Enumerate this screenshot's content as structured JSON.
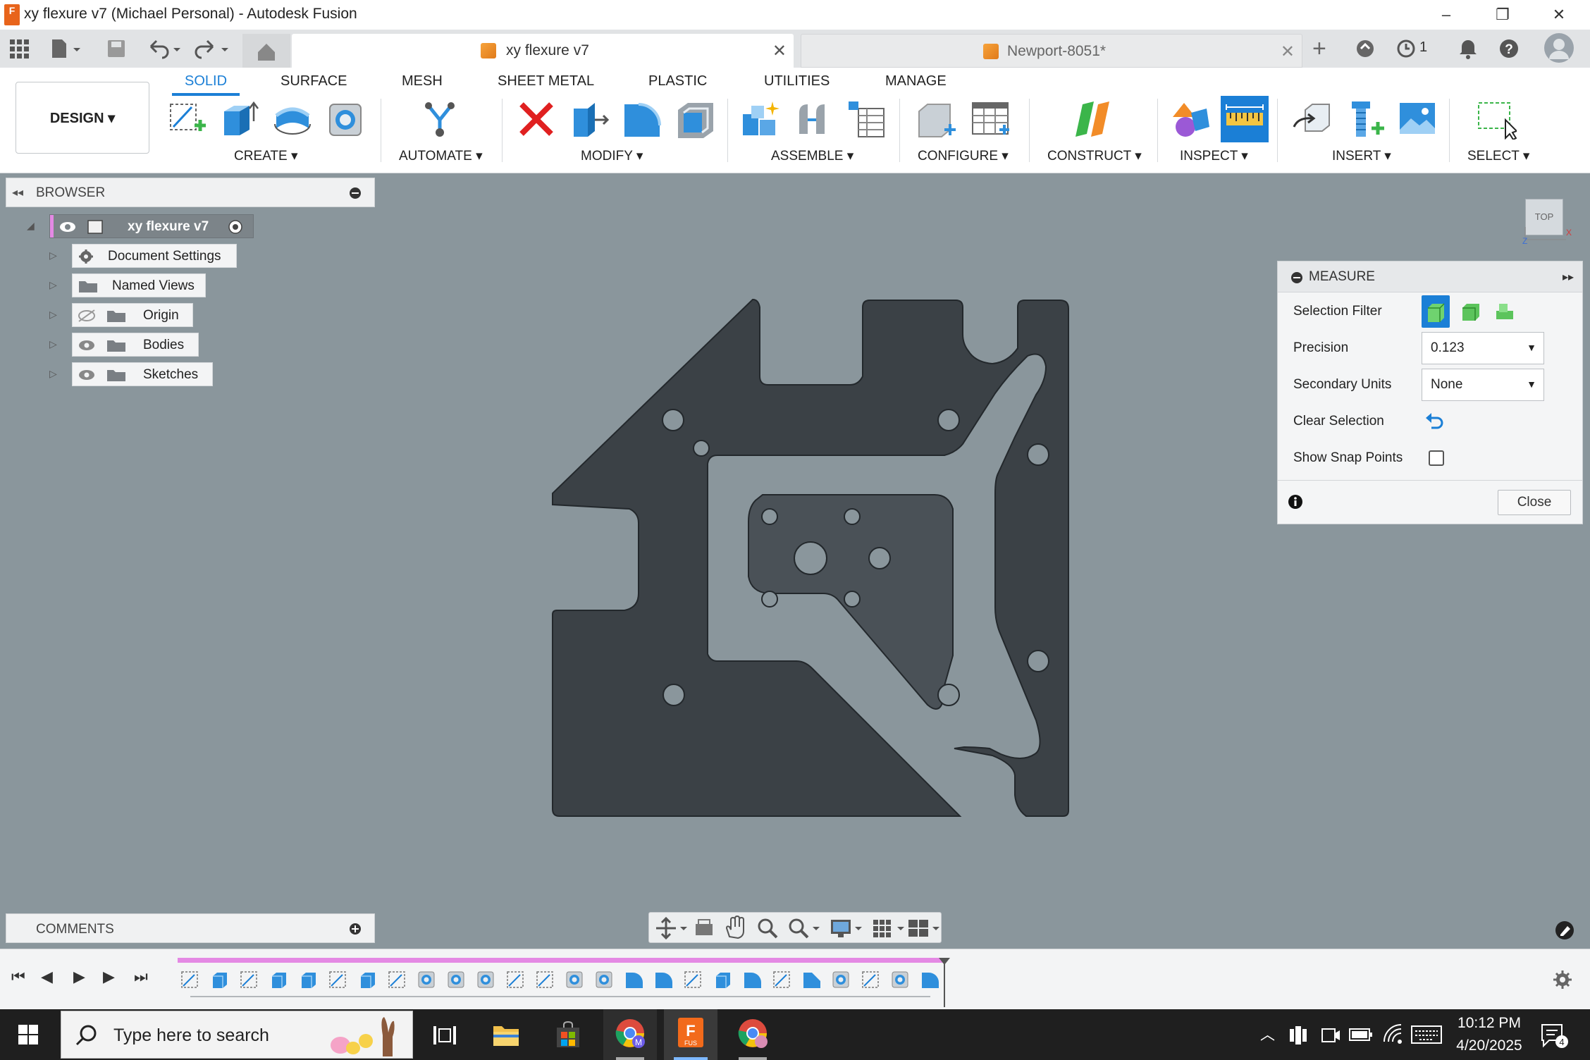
{
  "window": {
    "title": "xy flexure v7 (Michael Personal) - Autodesk Fusion",
    "app_icon_letter": "F"
  },
  "tabs": [
    {
      "label": "xy flexure v7",
      "active": true
    },
    {
      "label": "Newport-8051*",
      "active": false
    }
  ],
  "tabbar": {
    "job_count": "1"
  },
  "ribbon": {
    "workspace": "DESIGN",
    "tabs": [
      "SOLID",
      "SURFACE",
      "MESH",
      "SHEET METAL",
      "PLASTIC",
      "UTILITIES",
      "MANAGE"
    ],
    "groups": [
      "CREATE",
      "AUTOMATE",
      "MODIFY",
      "ASSEMBLE",
      "CONFIGURE",
      "CONSTRUCT",
      "INSPECT",
      "INSERT",
      "SELECT"
    ]
  },
  "browser": {
    "title": "BROWSER",
    "root": "xy flexure v7",
    "items": [
      "Document Settings",
      "Named Views",
      "Origin",
      "Bodies",
      "Sketches"
    ]
  },
  "viewcube": {
    "label": "TOP"
  },
  "measure": {
    "title": "MEASURE",
    "selection_filter_label": "Selection Filter",
    "precision_label": "Precision",
    "precision_value": "0.123",
    "secondary_units_label": "Secondary Units",
    "secondary_units_value": "None",
    "clear_selection_label": "Clear Selection",
    "show_snap_points_label": "Show Snap Points",
    "close_label": "Close"
  },
  "comments": {
    "title": "COMMENTS"
  },
  "taskbar": {
    "search_placeholder": "Type here to search",
    "time": "10:12 PM",
    "date": "4/20/2025",
    "notification_count": "4",
    "fusion_icon_label": "FUS"
  },
  "colors": {
    "accent": "#1b7fd6",
    "viewport": "#8a969c",
    "part": "#3b4146",
    "timeline_bar": "#e489e4"
  }
}
